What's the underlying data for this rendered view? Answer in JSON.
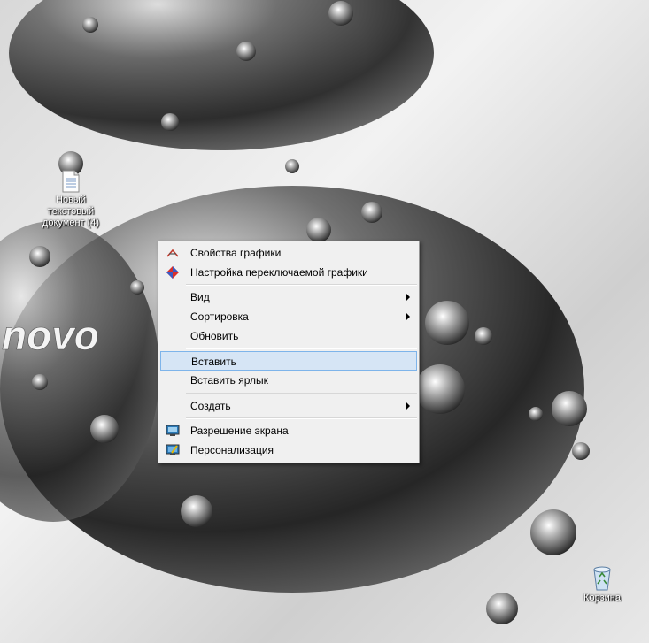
{
  "desktop": {
    "wallpaper_logo_text": "novo",
    "icons": {
      "text_document": {
        "label": "Новый текстовый документ (4)"
      },
      "recycle_bin": {
        "label": "Корзина"
      }
    }
  },
  "context_menu": {
    "items": [
      {
        "label": "Свойства графики",
        "icon": "graphics-properties-icon"
      },
      {
        "label": "Настройка переключаемой графики",
        "icon": "switchable-graphics-icon"
      },
      {
        "label": "Вид",
        "submenu": true
      },
      {
        "label": "Сортировка",
        "submenu": true
      },
      {
        "label": "Обновить"
      },
      {
        "label": "Вставить",
        "highlighted": true
      },
      {
        "label": "Вставить ярлык"
      },
      {
        "label": "Создать",
        "submenu": true
      },
      {
        "label": "Разрешение экрана",
        "icon": "screen-resolution-icon"
      },
      {
        "label": "Персонализация",
        "icon": "personalization-icon"
      }
    ]
  }
}
